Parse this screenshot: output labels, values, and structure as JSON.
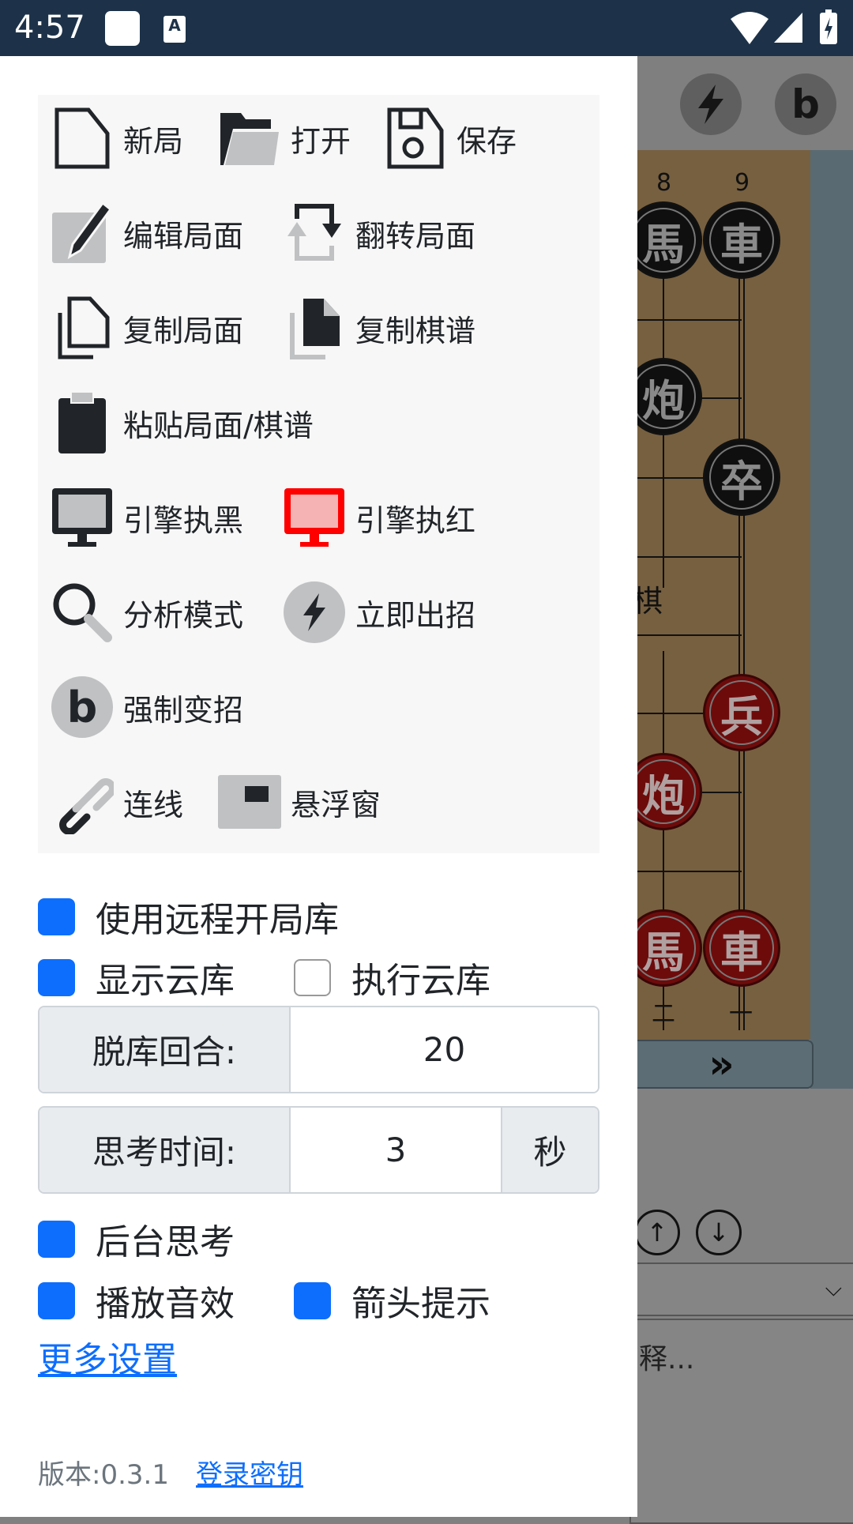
{
  "status_bar": {
    "time": "4:57"
  },
  "background": {
    "toolbar_buttons": [
      {
        "icon": "lightning-icon"
      },
      {
        "label": "b"
      }
    ],
    "column_numbers": [
      "8",
      "9"
    ],
    "bottom_numbers": [
      "二",
      "一"
    ],
    "pieces": [
      {
        "char": "馬",
        "color": "black"
      },
      {
        "char": "車",
        "color": "black"
      },
      {
        "char": "炮",
        "color": "black"
      },
      {
        "char": "卒",
        "color": "black"
      },
      {
        "char": "兵",
        "color": "red"
      },
      {
        "char": "炮",
        "color": "red"
      },
      {
        "char": "馬",
        "color": "red"
      },
      {
        "char": "車",
        "color": "red"
      }
    ],
    "river_text": "棋",
    "forward_button": "»",
    "comment_placeholder": "释..."
  },
  "menu": {
    "new": "新局",
    "open": "打开",
    "save": "保存",
    "edit": "编辑局面",
    "flip": "翻转局面",
    "copy_position": "复制局面",
    "copy_record": "复制棋谱",
    "paste": "粘贴局面/棋谱",
    "engine_black": "引擎执黑",
    "engine_red": "引擎执红",
    "analysis": "分析模式",
    "move_now": "立即出招",
    "force_change": "强制变招",
    "b_letter": "b",
    "connect": "连线",
    "float_window": "悬浮窗"
  },
  "settings": {
    "remote_book": {
      "label": "使用远程开局库",
      "checked": true
    },
    "show_cloud": {
      "label": "显示云库",
      "checked": true
    },
    "run_cloud": {
      "label": "执行云库",
      "checked": false
    },
    "leave_book": {
      "label": "脱库回合:",
      "value": "20"
    },
    "think_time": {
      "label": "思考时间:",
      "value": "3",
      "unit": "秒"
    },
    "background_think": {
      "label": "后台思考",
      "checked": true
    },
    "sound": {
      "label": "播放音效",
      "checked": true
    },
    "arrow_hint": {
      "label": "箭头提示",
      "checked": true
    },
    "more": "更多设置"
  },
  "footer": {
    "version": "版本:0.3.1",
    "login_key": "登录密钥"
  },
  "colors": {
    "accent": "#0d6efd",
    "status_bar": "#1d3249"
  }
}
